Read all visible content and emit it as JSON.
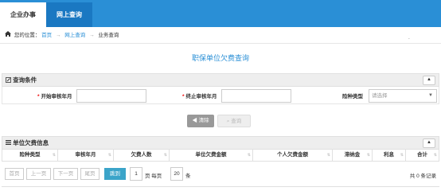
{
  "topnav": {
    "tab_enterprise": "企业办事",
    "tab_online_query": "网上查询"
  },
  "breadcrumb": {
    "prefix": "您的位置：",
    "home": "首页",
    "sep": "→",
    "query": "网上查询",
    "current": "业务查询",
    "dot": "."
  },
  "page_title": "职保单位欠费查询",
  "query": {
    "header": "查询条件",
    "start_label": "开始审核年月",
    "end_label": "终止审核年月",
    "type_label": "险种类型",
    "type_placeholder": "请选择"
  },
  "buttons": {
    "clear": "清除",
    "query": "查询"
  },
  "grid": {
    "header": "单位欠费信息",
    "columns": [
      "险种类型",
      "审核年月",
      "欠费人数",
      "单位欠费金额",
      "个人欠费金额",
      "滞纳金",
      "利息",
      "合计"
    ]
  },
  "pager": {
    "first": "首页",
    "prev": "上一页",
    "next": "下一页",
    "last": "尾页",
    "goto": "跳到",
    "page_value": "1",
    "page_unit": "页 每页",
    "size_value": "20",
    "size_unit": "条",
    "total": "共 0 条记录"
  },
  "colors": {
    "primary": "#2a8fd6",
    "active_tab": "#1a78c2",
    "go_button": "#3ba4c9",
    "required": "#e00000"
  }
}
